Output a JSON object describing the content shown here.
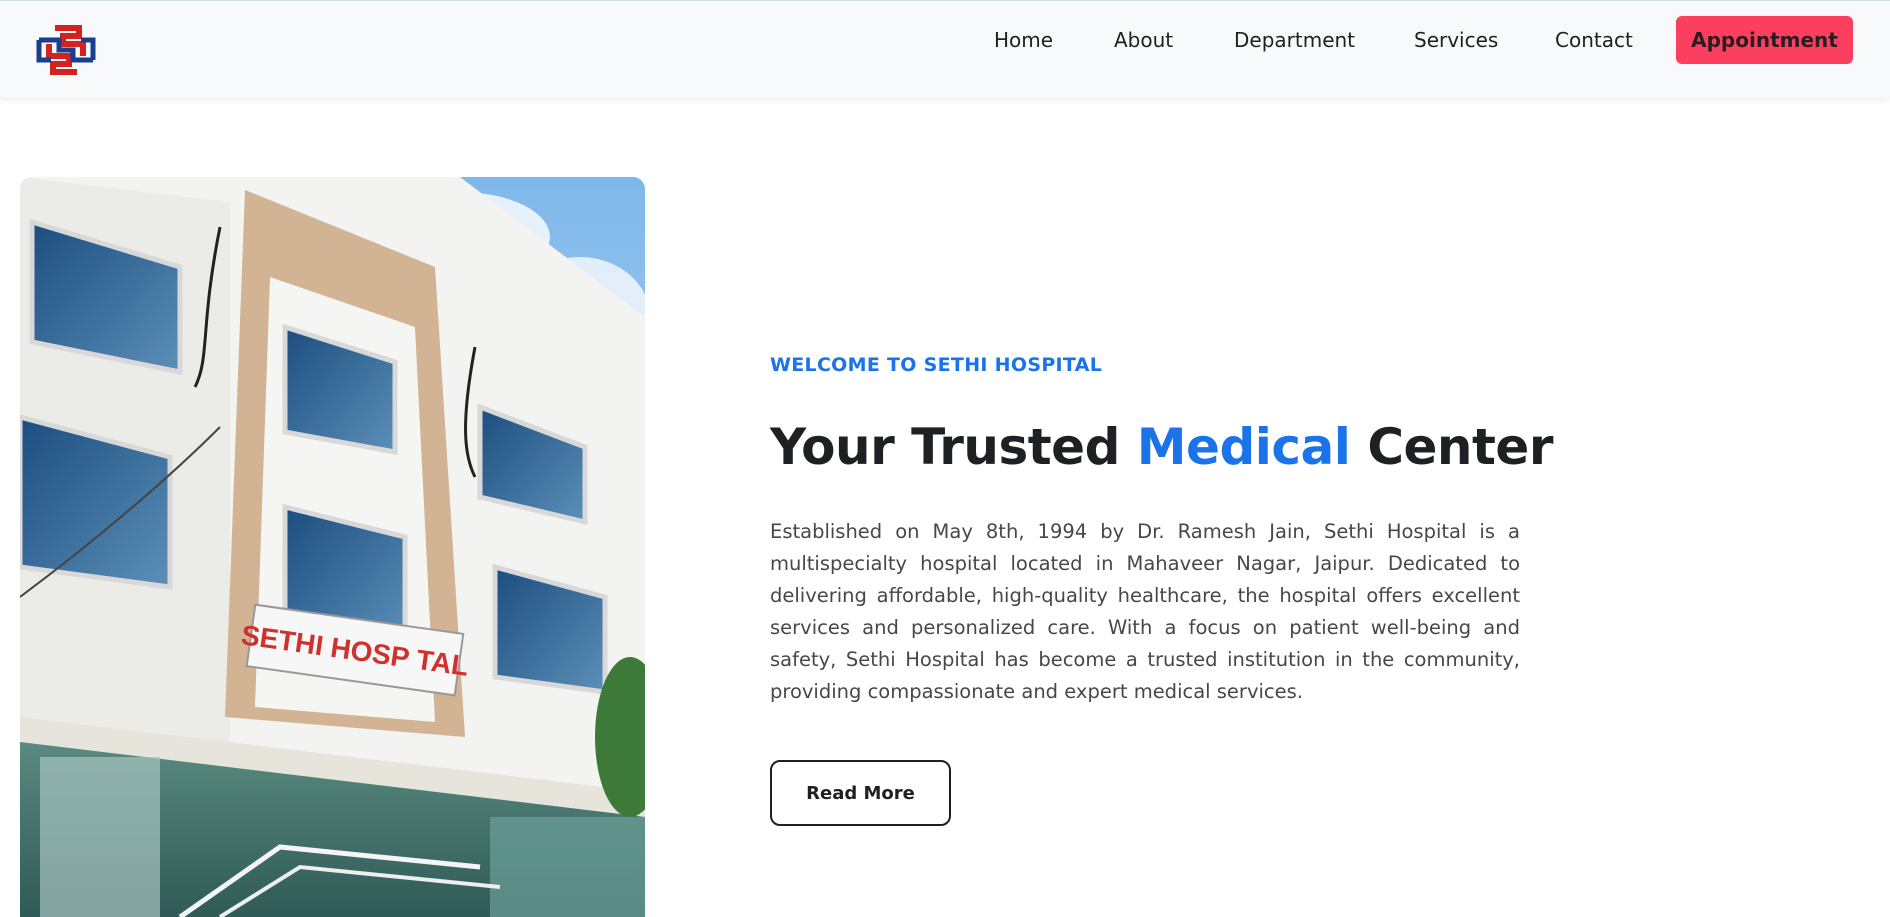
{
  "header": {
    "logo_icon": "sethi-hospital-logo-icon",
    "nav": [
      {
        "label": "Home"
      },
      {
        "label": "About"
      },
      {
        "label": "Department"
      },
      {
        "label": "Services"
      },
      {
        "label": "Contact"
      }
    ],
    "cta_label": "Appointment",
    "cta_color": "#fd3f5f"
  },
  "hero": {
    "photo_sign_text": "SETHI HOSP TAL",
    "kicker": "WELCOME TO SETHI HOSPITAL",
    "title_before": "Your Trusted ",
    "title_accent": "Medical",
    "title_after": " Center",
    "description": "Established on May 8th, 1994 by Dr. Ramesh Jain, Sethi Hospital is a multispecialty hospital located in Mahaveer Nagar, Jaipur. Dedicated to delivering affordable, high-quality healthcare, the hospital offers excellent services and personalized care. With a focus on patient well-being and safety, Sethi Hospital has become a trusted institution in the community, providing compassionate and expert medical services.",
    "read_more_label": "Read More",
    "accent_color": "#1a73e8"
  }
}
